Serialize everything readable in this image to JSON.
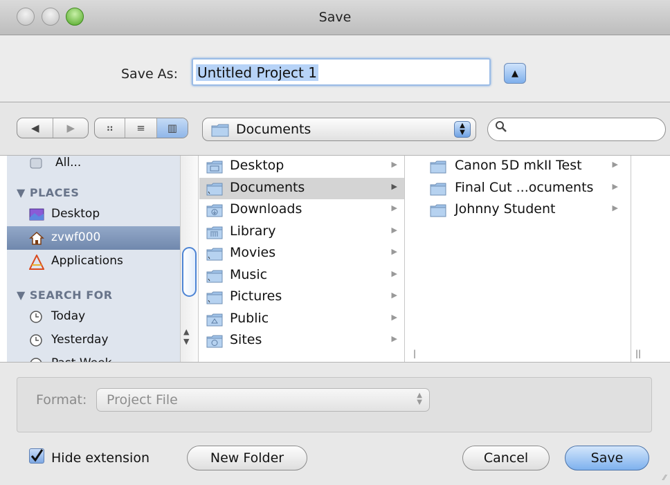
{
  "window": {
    "title": "Save",
    "colors": {
      "accent": "#7eb1ee",
      "sidebar": "#dfe5ee",
      "selection": "#7088ad"
    }
  },
  "saveas": {
    "label": "Save As:",
    "value": "Untitled Project 1",
    "expand_glyph": "▲"
  },
  "toolbar": {
    "back_glyph": "◀",
    "forward_glyph": "▶",
    "view_icon_glyph": "⠶",
    "view_list_glyph": "≡",
    "view_column_glyph": "▥",
    "location": "Documents",
    "stepper_glyph": "▲▼",
    "search_glyph": "⚲",
    "search_value": ""
  },
  "sidebar": {
    "top_item": "All...",
    "places_header": "▼ PLACES",
    "places": [
      "Desktop",
      "zvwf000",
      "Applications"
    ],
    "search_header": "▼ SEARCH FOR",
    "search_items": [
      "Today",
      "Yesterday",
      "Past Week"
    ]
  },
  "column1": {
    "items": [
      "Desktop",
      "Documents",
      "Downloads",
      "Library",
      "Movies",
      "Music",
      "Pictures",
      "Public",
      "Sites"
    ]
  },
  "column2": {
    "items": [
      "Canon 5D mkII Test",
      "Final Cut ...ocuments",
      "Johnny Student"
    ]
  },
  "format": {
    "label": "Format:",
    "value": "Project File"
  },
  "bottom": {
    "hide_extension": "Hide extension",
    "new_folder": "New Folder",
    "cancel": "Cancel",
    "save": "Save"
  }
}
